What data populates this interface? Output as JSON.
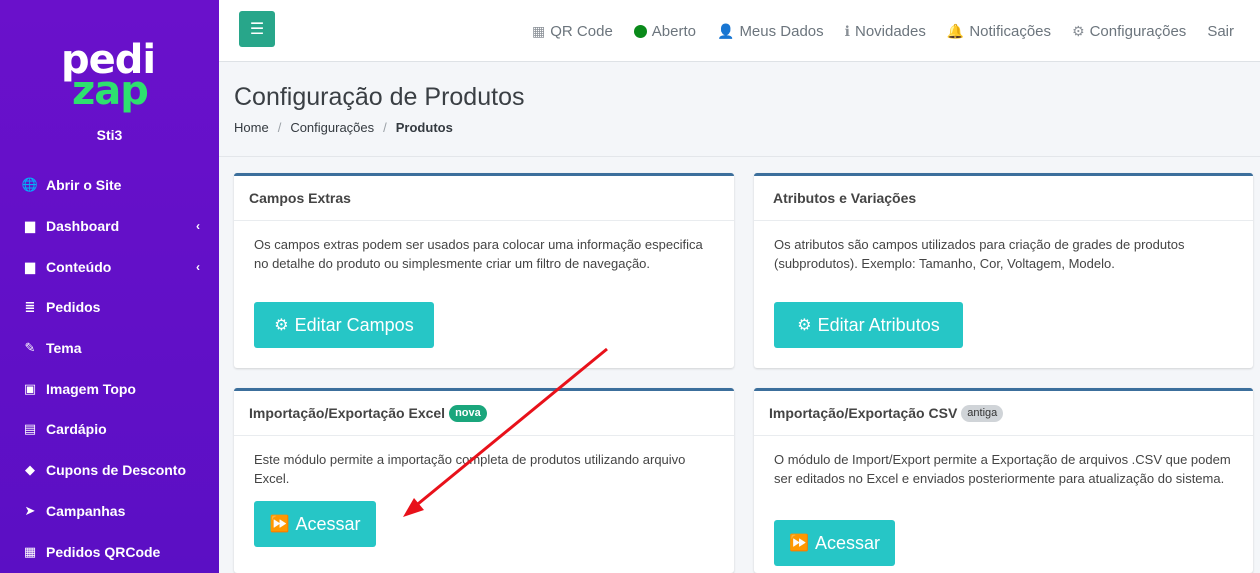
{
  "sidebar": {
    "logo_top": "pedi",
    "logo_bottom": "zap",
    "store_name": "Sti3",
    "items": [
      {
        "label": "Abrir o Site",
        "icon": "globe-icon",
        "glyph": "🌐"
      },
      {
        "label": "Dashboard",
        "icon": "document-icon",
        "glyph": "▆",
        "chevron": "‹"
      },
      {
        "label": "Conteúdo",
        "icon": "document-icon",
        "glyph": "▆",
        "chevron": "‹"
      },
      {
        "label": "Pedidos",
        "icon": "orders-icon",
        "glyph": "≣"
      },
      {
        "label": "Tema",
        "icon": "brush-icon",
        "glyph": "✎"
      },
      {
        "label": "Imagem Topo",
        "icon": "image-icon",
        "glyph": "▣"
      },
      {
        "label": "Cardápio",
        "icon": "book-icon",
        "glyph": "▤"
      },
      {
        "label": "Cupons de Desconto",
        "icon": "tags-icon",
        "glyph": "◆"
      },
      {
        "label": "Campanhas",
        "icon": "paper-plane-icon",
        "glyph": "➤"
      },
      {
        "label": "Pedidos QRCode",
        "icon": "qrcode-icon",
        "glyph": "▦"
      }
    ]
  },
  "topbar": {
    "menu_glyph": "☰",
    "items": [
      {
        "label": "QR Code",
        "icon": "qrcode-icon",
        "glyph": "▦"
      },
      {
        "label": "Aberto",
        "icon": "status-dot-icon"
      },
      {
        "label": "Meus Dados",
        "icon": "user-icon",
        "glyph": "👤"
      },
      {
        "label": "Novidades",
        "icon": "info-icon",
        "glyph": "ℹ"
      },
      {
        "label": "Notificações",
        "icon": "bell-icon",
        "glyph": "🔔"
      },
      {
        "label": "Configurações",
        "icon": "gear-icon",
        "glyph": "⚙"
      },
      {
        "label": "Sair"
      }
    ]
  },
  "page": {
    "title": "Configuração de Produtos",
    "breadcrumb": [
      "Home",
      "Configurações",
      "Produtos"
    ],
    "breadcrumb_sep": "/"
  },
  "cards": {
    "campos": {
      "title": "Campos Extras",
      "text": "Os campos extras podem ser usados para colocar uma informação especifica no detalhe do produto ou simplesmente criar um filtro de navegação.",
      "button": "Editar Campos",
      "button_glyph": "⚙"
    },
    "atributos": {
      "title": "Atributos e Variações",
      "text": "Os atributos são campos utilizados para criação de grades de produtos (subprodutos). Exemplo: Tamanho, Cor, Voltagem, Modelo.",
      "button": "Editar Atributos",
      "button_glyph": "⚙"
    },
    "excel": {
      "title": "Importação/Exportação Excel",
      "badge": "nova",
      "text": "Este módulo permite a importação completa de produtos utilizando arquivo Excel.",
      "button": "Acessar",
      "button_glyph": "⏩"
    },
    "csv": {
      "title": "Importação/Exportação CSV",
      "badge": "antiga",
      "text": "O módulo de Import/Export permite a Exportação de arquivos .CSV que podem ser editados no Excel e enviados posteriormente para atualização do sistema.",
      "button": "Acessar",
      "button_glyph": "⏩"
    }
  },
  "colors": {
    "sidebar": "#6a11cb",
    "accent_green": "#2ee06f",
    "button": "#26c6c6",
    "card_border": "#3c6f9c",
    "arrow": "#e8111a"
  }
}
